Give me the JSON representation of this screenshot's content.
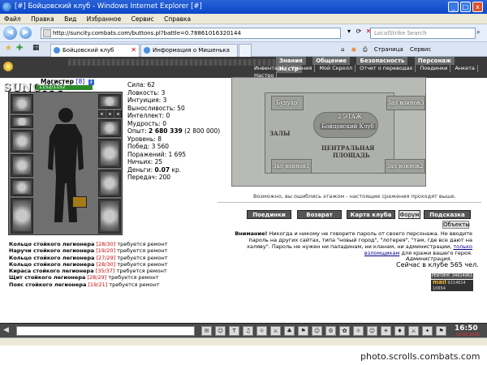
{
  "window": {
    "title": "[#] Бойцовский клуб - Windows Internet Explorer [#]",
    "controls": [
      "_",
      "□",
      "x"
    ]
  },
  "menu": [
    "Файл",
    "Правка",
    "Вид",
    "Избранное",
    "Сервис",
    "Справка"
  ],
  "address": {
    "url": "http://suncity.combats.com/buttons.pl?battle=0.78861016320144",
    "search_placeholder": "LocalStrike Search"
  },
  "tabs": [
    {
      "label": "Бойцовский клуб",
      "active": true
    },
    {
      "label": "Информация о Мишенька",
      "active": false
    }
  ],
  "commands": [
    "Страница",
    "Сервис"
  ],
  "game": {
    "logo": "SUNCITY",
    "top_links": [
      "Знания",
      "Общение",
      "Безопасность",
      "Персонаж",
      "Настр"
    ],
    "sub_links": [
      "Инвентарь",
      "Умения",
      "Мой Скролл",
      "Отчет о переводах",
      "Поединки",
      "Анкета",
      "Настро"
    ]
  },
  "character": {
    "name": "Магистер",
    "level": "[8]",
    "info_icon": "i",
    "hp": "1152/1152",
    "stats": [
      "Сила: 62",
      "Ловкость: 3",
      "Интуиция: 3",
      "Выносливость: 50",
      "Интеллект: 0",
      "Мудрость: 0"
    ],
    "exp_label": "Опыт:",
    "exp_value": "2 680 339",
    "exp_next": "(2 800 000)",
    "stats2": [
      "Уровень: 8",
      "Побед: 3 560",
      "Поражений: 1 695",
      "Ничьих: 25"
    ],
    "money_label": "Деньги:",
    "money_value": "0.07",
    "money_unit": "кр.",
    "transfers": "Передач: 200"
  },
  "items": [
    {
      "name": "Кольцо стойкого легионера",
      "dur": "[28/30]",
      "note": "требуется ремонт"
    },
    {
      "name": "Наручи стойкого легионера",
      "dur": "[19/20]",
      "note": "требуется ремонт"
    },
    {
      "name": "Кольцо стойкого легионера",
      "dur": "[27/29]",
      "note": "требуется ремонт"
    },
    {
      "name": "Кольцо стойкого легионера",
      "dur": "[28/30]",
      "note": "требуется ремонт"
    },
    {
      "name": "Кираса стойкого легионера",
      "dur": "[35/37]",
      "note": "требуется ремонт"
    },
    {
      "name": "Щит стойкого легионера",
      "dur": "[28/29]",
      "note": "требуется ремонт"
    },
    {
      "name": "Пояс стойкого легионера",
      "dur": "[19/21]",
      "note": "требуется ремонт"
    }
  ],
  "map": {
    "rooms": {
      "boudoir": "Будуар",
      "hall3": "Зал воинов3",
      "floor2": "2 ЭТАЖ",
      "club": "Бойцовский Клуб",
      "halls": "ЗАЛЫ",
      "square_line1": "ЦЕНТРАЛЬНАЯ",
      "square_line2": "ПЛОЩАДЬ",
      "hall1": "Зал воинов1",
      "hall2": "Зал воинов2"
    },
    "message": "Возможно, вы ошиблись этажом - настоящие сражения проходят выше."
  },
  "actions": {
    "fights": "Поединки",
    "back": "Возврат",
    "club_map": "Карта клуба",
    "forum": "Форум",
    "hint": "Подсказка",
    "objects": "Объекты"
  },
  "notice": {
    "warning": "Внимание!",
    "text": "Никогда и никому не говорите пароль от своего персонажа. Не вводите пароль на других сайтах, типа \"новый город\", \"лотерея\", \"там, где все дают на халяву\". Пароль не нужен ни паладинам, ни кланам, ни администрации,",
    "link": "только взломщикам",
    "text_end": "для кражи вашего героя.",
    "signature": "Администрация.",
    "online": "Сейчас в клубе 565 чел."
  },
  "counters": {
    "rating_label": "РЕЙТИНГ",
    "rating_val": "34614961",
    "mail_label": "mail",
    "mail_nums": "9214614 10654"
  },
  "chat": {
    "icons": [
      "✉",
      "☺",
      "T",
      "♫",
      "☼",
      "⚔",
      "♣",
      "⚑",
      "☺",
      "⚙",
      "✿",
      "☼",
      "☺",
      "☀",
      "♦",
      "⚔",
      "✦",
      "⚑"
    ],
    "time": "16:50",
    "date": "10.02.2010"
  },
  "watermark": "photo.scrolls.combats.com"
}
